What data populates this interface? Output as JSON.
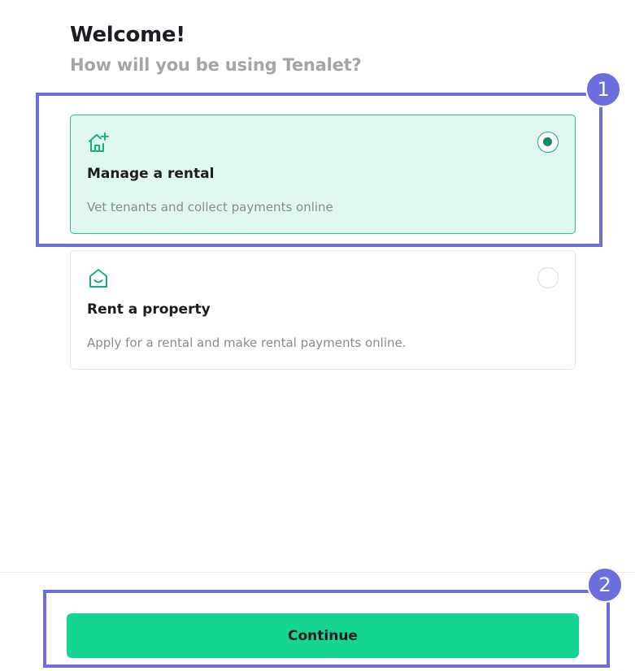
{
  "header": {
    "title": "Welcome!",
    "subtitle": "How will you be using Tenalet?"
  },
  "options": [
    {
      "title": "Manage a rental",
      "description": "Vet tenants and collect payments online",
      "icon": "house-plus-icon",
      "selected": true
    },
    {
      "title": "Rent a property",
      "description": "Apply for a rental and make rental payments online.",
      "icon": "house-smile-icon",
      "selected": false
    }
  ],
  "footer": {
    "continue_label": "Continue"
  },
  "annotations": [
    "1",
    "2"
  ],
  "colors": {
    "accent": "#14d690",
    "selected_bg": "#e1f8ef",
    "annotation": "#6b6ede"
  }
}
